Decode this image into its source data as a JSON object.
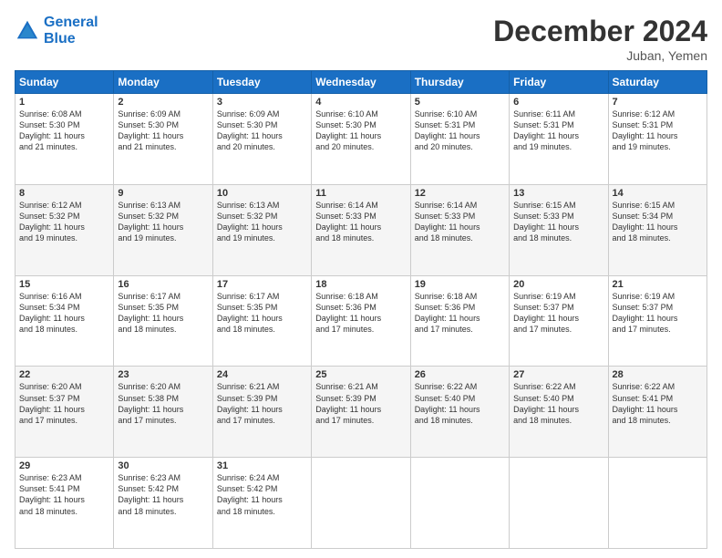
{
  "header": {
    "logo_line1": "General",
    "logo_line2": "Blue",
    "month_title": "December 2024",
    "location": "Juban, Yemen"
  },
  "days_of_week": [
    "Sunday",
    "Monday",
    "Tuesday",
    "Wednesday",
    "Thursday",
    "Friday",
    "Saturday"
  ],
  "weeks": [
    [
      {
        "day": "1",
        "sunrise": "6:08 AM",
        "sunset": "5:30 PM",
        "daylight": "11 hours and 21 minutes."
      },
      {
        "day": "2",
        "sunrise": "6:09 AM",
        "sunset": "5:30 PM",
        "daylight": "11 hours and 21 minutes."
      },
      {
        "day": "3",
        "sunrise": "6:09 AM",
        "sunset": "5:30 PM",
        "daylight": "11 hours and 20 minutes."
      },
      {
        "day": "4",
        "sunrise": "6:10 AM",
        "sunset": "5:30 PM",
        "daylight": "11 hours and 20 minutes."
      },
      {
        "day": "5",
        "sunrise": "6:10 AM",
        "sunset": "5:31 PM",
        "daylight": "11 hours and 20 minutes."
      },
      {
        "day": "6",
        "sunrise": "6:11 AM",
        "sunset": "5:31 PM",
        "daylight": "11 hours and 19 minutes."
      },
      {
        "day": "7",
        "sunrise": "6:12 AM",
        "sunset": "5:31 PM",
        "daylight": "11 hours and 19 minutes."
      }
    ],
    [
      {
        "day": "8",
        "sunrise": "6:12 AM",
        "sunset": "5:32 PM",
        "daylight": "11 hours and 19 minutes."
      },
      {
        "day": "9",
        "sunrise": "6:13 AM",
        "sunset": "5:32 PM",
        "daylight": "11 hours and 19 minutes."
      },
      {
        "day": "10",
        "sunrise": "6:13 AM",
        "sunset": "5:32 PM",
        "daylight": "11 hours and 19 minutes."
      },
      {
        "day": "11",
        "sunrise": "6:14 AM",
        "sunset": "5:33 PM",
        "daylight": "11 hours and 18 minutes."
      },
      {
        "day": "12",
        "sunrise": "6:14 AM",
        "sunset": "5:33 PM",
        "daylight": "11 hours and 18 minutes."
      },
      {
        "day": "13",
        "sunrise": "6:15 AM",
        "sunset": "5:33 PM",
        "daylight": "11 hours and 18 minutes."
      },
      {
        "day": "14",
        "sunrise": "6:15 AM",
        "sunset": "5:34 PM",
        "daylight": "11 hours and 18 minutes."
      }
    ],
    [
      {
        "day": "15",
        "sunrise": "6:16 AM",
        "sunset": "5:34 PM",
        "daylight": "11 hours and 18 minutes."
      },
      {
        "day": "16",
        "sunrise": "6:17 AM",
        "sunset": "5:35 PM",
        "daylight": "11 hours and 18 minutes."
      },
      {
        "day": "17",
        "sunrise": "6:17 AM",
        "sunset": "5:35 PM",
        "daylight": "11 hours and 18 minutes."
      },
      {
        "day": "18",
        "sunrise": "6:18 AM",
        "sunset": "5:36 PM",
        "daylight": "11 hours and 17 minutes."
      },
      {
        "day": "19",
        "sunrise": "6:18 AM",
        "sunset": "5:36 PM",
        "daylight": "11 hours and 17 minutes."
      },
      {
        "day": "20",
        "sunrise": "6:19 AM",
        "sunset": "5:37 PM",
        "daylight": "11 hours and 17 minutes."
      },
      {
        "day": "21",
        "sunrise": "6:19 AM",
        "sunset": "5:37 PM",
        "daylight": "11 hours and 17 minutes."
      }
    ],
    [
      {
        "day": "22",
        "sunrise": "6:20 AM",
        "sunset": "5:37 PM",
        "daylight": "11 hours and 17 minutes."
      },
      {
        "day": "23",
        "sunrise": "6:20 AM",
        "sunset": "5:38 PM",
        "daylight": "11 hours and 17 minutes."
      },
      {
        "day": "24",
        "sunrise": "6:21 AM",
        "sunset": "5:39 PM",
        "daylight": "11 hours and 17 minutes."
      },
      {
        "day": "25",
        "sunrise": "6:21 AM",
        "sunset": "5:39 PM",
        "daylight": "11 hours and 17 minutes."
      },
      {
        "day": "26",
        "sunrise": "6:22 AM",
        "sunset": "5:40 PM",
        "daylight": "11 hours and 18 minutes."
      },
      {
        "day": "27",
        "sunrise": "6:22 AM",
        "sunset": "5:40 PM",
        "daylight": "11 hours and 18 minutes."
      },
      {
        "day": "28",
        "sunrise": "6:22 AM",
        "sunset": "5:41 PM",
        "daylight": "11 hours and 18 minutes."
      }
    ],
    [
      {
        "day": "29",
        "sunrise": "6:23 AM",
        "sunset": "5:41 PM",
        "daylight": "11 hours and 18 minutes."
      },
      {
        "day": "30",
        "sunrise": "6:23 AM",
        "sunset": "5:42 PM",
        "daylight": "11 hours and 18 minutes."
      },
      {
        "day": "31",
        "sunrise": "6:24 AM",
        "sunset": "5:42 PM",
        "daylight": "11 hours and 18 minutes."
      },
      null,
      null,
      null,
      null
    ]
  ],
  "labels": {
    "sunrise": "Sunrise:",
    "sunset": "Sunset:",
    "daylight": "Daylight:"
  }
}
